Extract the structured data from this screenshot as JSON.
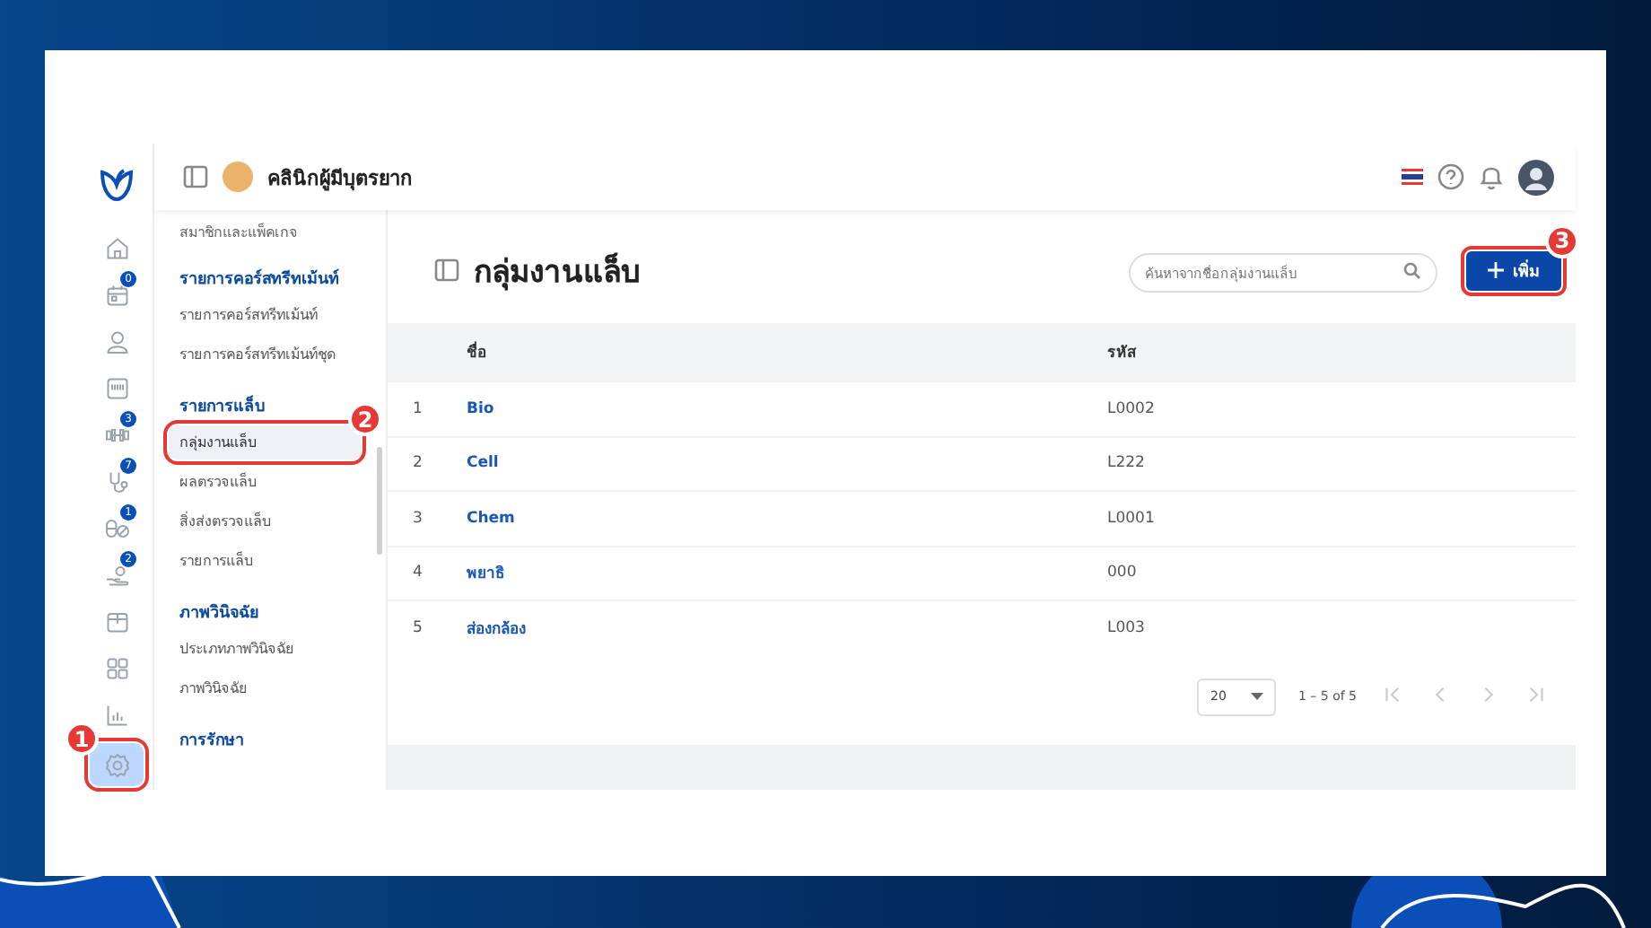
{
  "header": {
    "clinic_name": "คลินิกผู้มีบุตรยาก"
  },
  "rail": {
    "items": [
      {
        "selected": false
      },
      {
        "selected": false,
        "badge": "0"
      },
      {
        "selected": false
      },
      {
        "selected": false
      },
      {
        "selected": false,
        "badge": "3"
      },
      {
        "selected": false,
        "badge": "7"
      },
      {
        "selected": false,
        "badge": "1"
      },
      {
        "selected": false,
        "badge": "2"
      },
      {
        "selected": false
      },
      {
        "selected": false
      },
      {
        "selected": false
      },
      {
        "selected": true,
        "callout": "1"
      }
    ]
  },
  "sidebar": {
    "top_item": "สมาชิกและแพ็คเกจ",
    "sections": [
      {
        "title": "รายการคอร์สทรีทเม้นท์",
        "items": [
          {
            "label": "รายการคอร์สทรีทเม้นท์",
            "selected": false
          },
          {
            "label": "รายการคอร์สทรีทเม้นท์ชุด",
            "selected": false
          }
        ]
      },
      {
        "title": "รายการแล็บ",
        "items": [
          {
            "label": "กลุ่มงานแล็บ",
            "selected": true,
            "callout": "2"
          },
          {
            "label": "ผลตรวจแล็บ",
            "selected": false
          },
          {
            "label": "สิ่งส่งตรวจแล็บ",
            "selected": false
          },
          {
            "label": "รายการแล็บ",
            "selected": false
          }
        ]
      },
      {
        "title": "ภาพวินิจฉัย",
        "items": [
          {
            "label": "ประเภทภาพวินิจฉัย",
            "selected": false
          },
          {
            "label": "ภาพวินิจฉัย",
            "selected": false
          }
        ]
      },
      {
        "title": "การรักษา"
      }
    ]
  },
  "page": {
    "title": "กลุ่มงานแล็บ",
    "search": {
      "placeholder": "ค้นหาจากชื่อกลุ่มงานแล็บ"
    },
    "add_button": {
      "label": "เพิ่ม",
      "callout": "3"
    }
  },
  "table": {
    "columns": [
      "ชื่อ",
      "รหัส"
    ],
    "rows": [
      {
        "number": "1",
        "name": "Bio",
        "code": "L0002"
      },
      {
        "number": "2",
        "name": "Cell",
        "code": "L222"
      },
      {
        "number": "3",
        "name": "Chem",
        "code": "L0001"
      },
      {
        "number": "4",
        "name": "พยาธิ",
        "code": "000"
      },
      {
        "number": "5",
        "name": "ส่องกล้อง",
        "code": "L003"
      }
    ]
  },
  "pagination": {
    "page_size": "20",
    "range": "1 – 5 of 5",
    "nav_disabled": true
  }
}
